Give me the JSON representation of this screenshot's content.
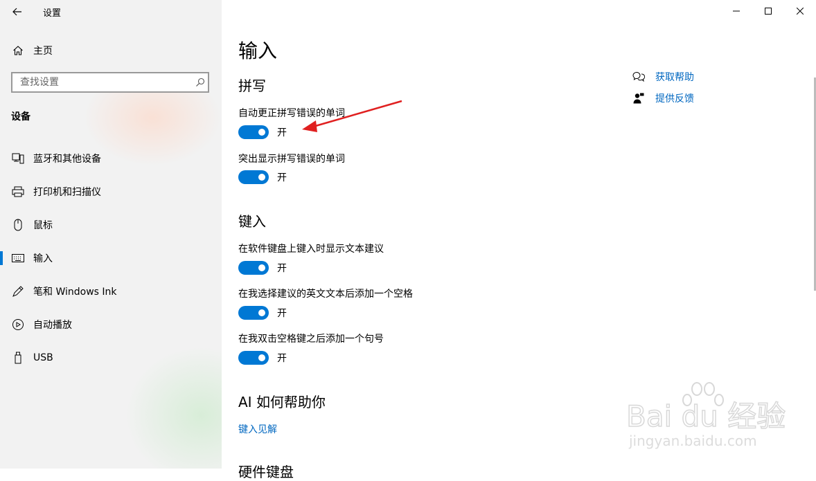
{
  "window": {
    "title": "设置",
    "controls": {
      "minimize": "minimize-icon",
      "maximize": "maximize-icon",
      "close": "close-icon"
    }
  },
  "sidebar": {
    "home_label": "主页",
    "search_placeholder": "查找设置",
    "section": "设备",
    "items": [
      {
        "label": "蓝牙和其他设备",
        "icon": "bluetooth-device-icon"
      },
      {
        "label": "打印机和扫描仪",
        "icon": "printer-icon"
      },
      {
        "label": "鼠标",
        "icon": "mouse-icon"
      },
      {
        "label": "输入",
        "icon": "keyboard-icon",
        "active": true
      },
      {
        "label": "笔和 Windows Ink",
        "icon": "pen-icon"
      },
      {
        "label": "自动播放",
        "icon": "autoplay-icon"
      },
      {
        "label": "USB",
        "icon": "usb-icon"
      }
    ]
  },
  "main": {
    "title": "输入",
    "spelling": {
      "heading": "拼写",
      "options": [
        {
          "label": "自动更正拼写错误的单词",
          "state": "开",
          "on": true
        },
        {
          "label": "突出显示拼写错误的单词",
          "state": "开",
          "on": true
        }
      ]
    },
    "typing": {
      "heading": "键入",
      "options": [
        {
          "label": "在软件键盘上键入时显示文本建议",
          "state": "开",
          "on": true
        },
        {
          "label": "在我选择建议的英文文本后添加一个空格",
          "state": "开",
          "on": true
        },
        {
          "label": "在我双击空格键之后添加一个句号",
          "state": "开",
          "on": true
        }
      ]
    },
    "ai": {
      "heading": "AI 如何帮助你",
      "link": "键入见解"
    },
    "next_heading_partial": "硬件键盘"
  },
  "help": {
    "get_help": "获取帮助",
    "feedback": "提供反馈"
  },
  "watermark": {
    "brand": "Bai du 经验",
    "url": "jingyan.baidu.com"
  },
  "colors": {
    "accent": "#0078d4",
    "link": "#0067c0",
    "annotation_arrow": "#e02020",
    "sidebar_bg": "#f2f2f2"
  }
}
